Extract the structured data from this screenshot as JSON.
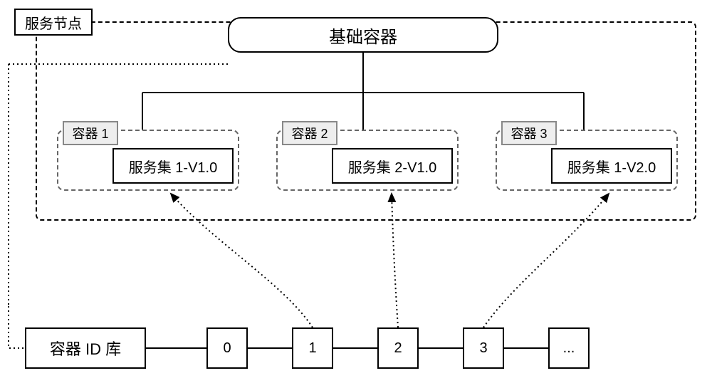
{
  "labels": {
    "service_node": "服务节点",
    "base_container": "基础容器",
    "container_id_lib": "容器 ID 库",
    "ellipsis": "..."
  },
  "containers": [
    {
      "label": "容器 1",
      "service": "服务集 1-V1.0"
    },
    {
      "label": "容器 2",
      "service": "服务集 2-V1.0"
    },
    {
      "label": "容器 3",
      "service": "服务集 1-V2.0"
    }
  ],
  "id_pool": [
    "0",
    "1",
    "2",
    "3"
  ],
  "diagram": {
    "description": "服务节点内的基础容器分支到三个容器(容器1/2/3)，每个容器包含一个服务集版本；容器ID库中编号1、2、3分别映射到容器1、容器2、容器3"
  }
}
